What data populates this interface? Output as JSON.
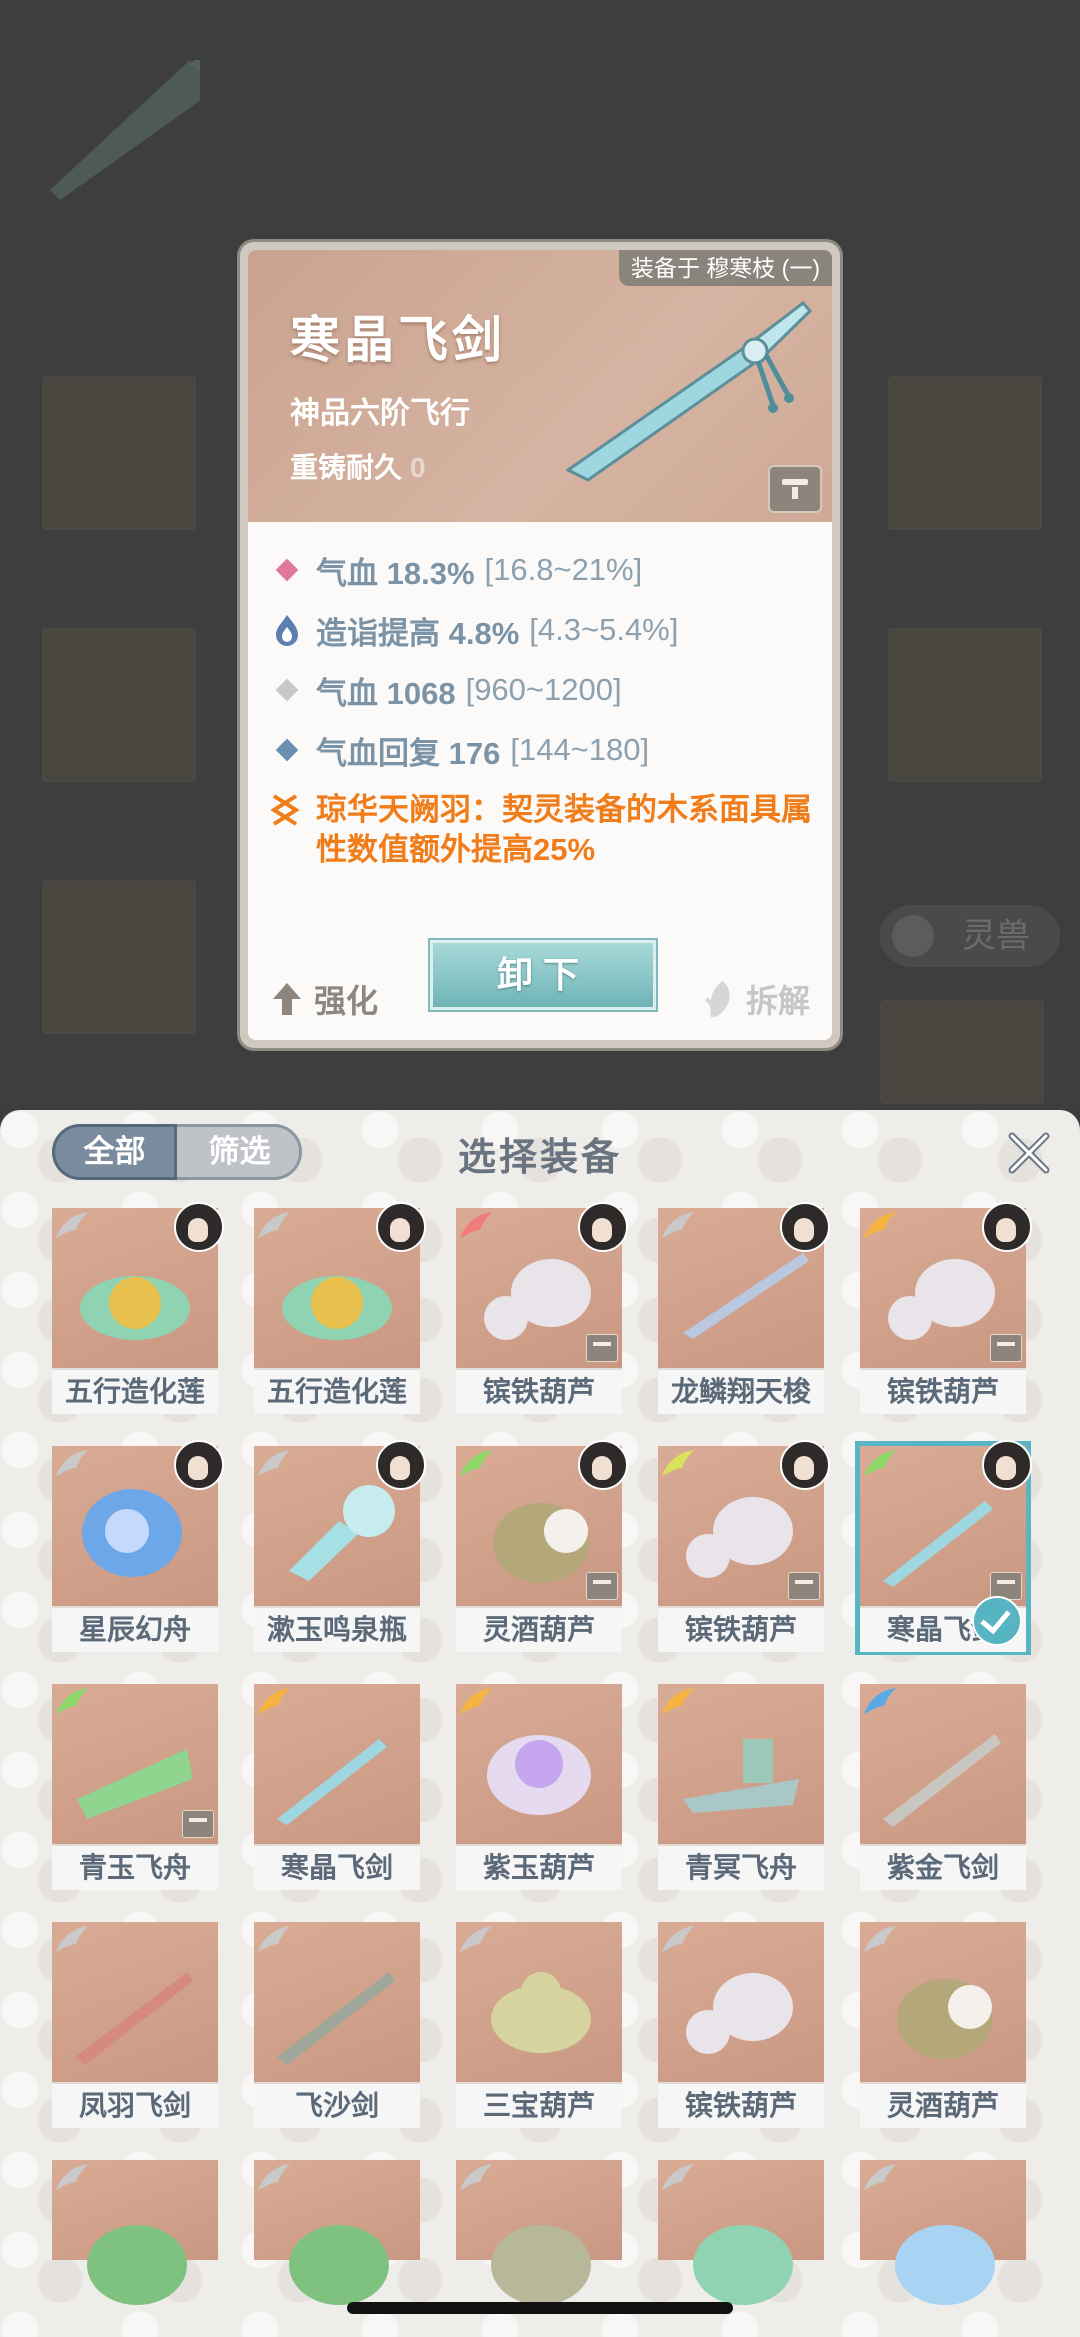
{
  "detail": {
    "equipped_by": "装备于 穆寒枝 (一)",
    "name": "寒晶飞剑",
    "grade": "神品六阶飞行",
    "durability_label": "重铸耐久",
    "durability_value": "0",
    "stats": [
      {
        "label": "气血 18.3%",
        "range": "[16.8~21%]",
        "icon": "pink-diamond-icon",
        "color": "#e0789a"
      },
      {
        "label": "造诣提高 4.8%",
        "range": "[4.3~5.4%]",
        "icon": "blue-flame-icon",
        "color": "#5b7fb0"
      },
      {
        "label": "气血 1068",
        "range": "[960~1200]",
        "icon": "gray-diamond-icon",
        "color": "#c8c8c8"
      },
      {
        "label": "气血回复 176",
        "range": "[144~180]",
        "icon": "blue-diamond-icon",
        "color": "#6a8fb3"
      }
    ],
    "special": "琼华天阙羽：契灵装备的木系面具属性数值额外提高25%",
    "enhance_label": "强化",
    "unequip_label": "卸下",
    "dismantle_label": "拆解"
  },
  "background": {
    "beast_label": "灵兽"
  },
  "panel": {
    "filter_all": "全部",
    "filter_select": "筛选",
    "title": "选择装备",
    "items": [
      {
        "name": "五行造化莲",
        "wing": "#c9c9c9",
        "avatar": true,
        "lock": false,
        "selected": false
      },
      {
        "name": "五行造化莲",
        "wing": "#c9c9c9",
        "avatar": true,
        "lock": false,
        "selected": false
      },
      {
        "name": "镔铁葫芦",
        "wing": "#f07c7c",
        "avatar": true,
        "lock": true,
        "selected": false
      },
      {
        "name": "龙鳞翔天梭",
        "wing": "#c9c9c9",
        "avatar": true,
        "lock": false,
        "selected": false
      },
      {
        "name": "镔铁葫芦",
        "wing": "#f5b342",
        "avatar": true,
        "lock": true,
        "selected": false
      },
      {
        "name": "星辰幻舟",
        "wing": "#c9c9c9",
        "avatar": true,
        "lock": false,
        "selected": false
      },
      {
        "name": "漱玉鸣泉瓶",
        "wing": "#c9c9c9",
        "avatar": true,
        "lock": false,
        "selected": false
      },
      {
        "name": "灵酒葫芦",
        "wing": "#8ed86a",
        "avatar": true,
        "lock": true,
        "selected": false
      },
      {
        "name": "镔铁葫芦",
        "wing": "#d8e25a",
        "avatar": true,
        "lock": true,
        "selected": false
      },
      {
        "name": "寒晶飞剑",
        "wing": "#8ed86a",
        "avatar": true,
        "lock": true,
        "selected": true
      },
      {
        "name": "青玉飞舟",
        "wing": "#8ed86a",
        "avatar": false,
        "lock": true,
        "selected": false
      },
      {
        "name": "寒晶飞剑",
        "wing": "#f5b342",
        "avatar": false,
        "lock": false,
        "selected": false
      },
      {
        "name": "紫玉葫芦",
        "wing": "#f5b342",
        "avatar": false,
        "lock": false,
        "selected": false
      },
      {
        "name": "青冥飞舟",
        "wing": "#f5b342",
        "avatar": false,
        "lock": false,
        "selected": false
      },
      {
        "name": "紫金飞剑",
        "wing": "#5aa9e6",
        "avatar": false,
        "lock": false,
        "selected": false
      },
      {
        "name": "凤羽飞剑",
        "wing": "#c9c9c9",
        "avatar": false,
        "lock": false,
        "selected": false
      },
      {
        "name": "飞沙剑",
        "wing": "#c9c9c9",
        "avatar": false,
        "lock": false,
        "selected": false
      },
      {
        "name": "三宝葫芦",
        "wing": "#c9c9c9",
        "avatar": false,
        "lock": false,
        "selected": false
      },
      {
        "name": "镔铁葫芦",
        "wing": "#c9c9c9",
        "avatar": false,
        "lock": false,
        "selected": false
      },
      {
        "name": "灵酒葫芦",
        "wing": "#c9c9c9",
        "avatar": false,
        "lock": false,
        "selected": false
      }
    ]
  }
}
